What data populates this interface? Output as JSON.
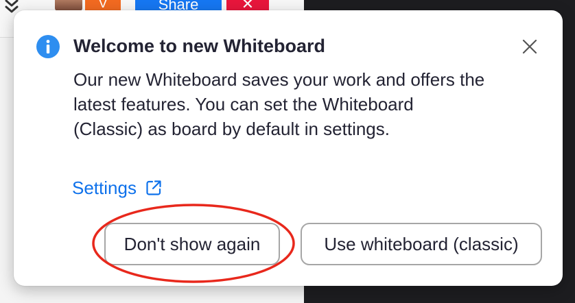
{
  "background": {
    "toolbar": {
      "v_label": "V",
      "share_label": "Share",
      "close_label": "✕"
    }
  },
  "dialog": {
    "title": "Welcome to new Whiteboard",
    "body": "Our new Whiteboard saves your work and offers the latest features. You can set the Whiteboard (Classic) as board by default in settings.",
    "settings_link": "Settings",
    "buttons": {
      "dont_show_again": "Don't show again",
      "use_classic": "Use whiteboard (classic)"
    }
  },
  "colors": {
    "link": "#0e71eb",
    "info_icon": "#2e8ef0",
    "annotation_ring": "#e8281c",
    "text": "#232333"
  },
  "icons": {
    "info": "info-icon",
    "close": "close-icon",
    "external_link": "external-link-icon",
    "expand": "double-chevron-down-icon"
  }
}
